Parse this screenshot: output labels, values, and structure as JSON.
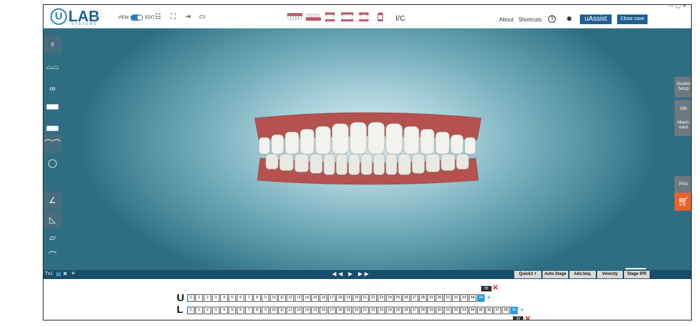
{
  "app": {
    "logo_mark": "U",
    "logo_text": "LAB",
    "logo_sub": "SYSTEMS",
    "case_title": "",
    "window_controls": "— ▢ ✕"
  },
  "toolbar": {
    "view_label": "VIEW",
    "edit_label": "EDIT",
    "icons": [
      "layout-icon",
      "fit-screen-icon",
      "export-icon",
      "monitor-icon"
    ],
    "view_buttons": [
      "upper-arch-view",
      "lower-arch-view",
      "front-view",
      "occlusal-view",
      "side-view",
      "single-tooth-view"
    ],
    "ic_label": "I/C",
    "about_label": "About",
    "shortcuts_label": "Shortcuts",
    "help_label": "?",
    "uassist_label": "uAssist",
    "close_case_label": "Close case"
  },
  "left_tools": [
    "crown-tool-icon",
    "tooth-pair-icon",
    "bite-icon",
    "upper-arch-icon",
    "lower-arch-icon",
    "teeth-row-icon",
    "shield-tooth-icon",
    "ruler-icon",
    "triangle-measure-icon",
    "grid-plane-icon",
    "arch-outline-icon"
  ],
  "right_panel": {
    "guided_setup": "Guided Setup",
    "om": "OM",
    "attachment": "Attach-ment",
    "print": "Print",
    "cart_icon": "cart-icon"
  },
  "timeline": {
    "tab_label": "Tx1",
    "play_controls": "◀◀ ▶ ▶▶",
    "buttons": [
      "Quick3 +",
      "Auto Stage",
      "Adv.Seq.",
      "Velocity",
      "Stage IPR"
    ]
  },
  "staging": {
    "upper": {
      "label": "U",
      "stages": [
        "0",
        "1",
        "2",
        "3",
        "4",
        "5",
        "6",
        "7",
        "8",
        "9",
        "10",
        "11",
        "12",
        "13",
        "14",
        "15",
        "16",
        "17",
        "18",
        "19",
        "20",
        "21",
        "22",
        "23",
        "24",
        "25",
        "26",
        "27",
        "28",
        "29",
        "30",
        "31",
        "32",
        "33",
        "34",
        "35"
      ],
      "tag": "35"
    },
    "lower": {
      "label": "L",
      "stages": [
        "0",
        "1",
        "2",
        "3",
        "4",
        "5",
        "6",
        "7",
        "8",
        "9",
        "10",
        "11",
        "12",
        "13",
        "14",
        "15",
        "16",
        "17",
        "18",
        "19",
        "20",
        "21",
        "22",
        "23",
        "24",
        "25",
        "26",
        "27",
        "28",
        "29",
        "30",
        "31",
        "32",
        "33",
        "34",
        "35",
        "36",
        "37",
        "38",
        "39"
      ],
      "tag": "39"
    }
  },
  "colors": {
    "brand_blue": "#1f5f94",
    "accent_blue": "#2a9ad8",
    "cart_orange": "#e8622c",
    "timeline_bar": "#184e6a"
  }
}
